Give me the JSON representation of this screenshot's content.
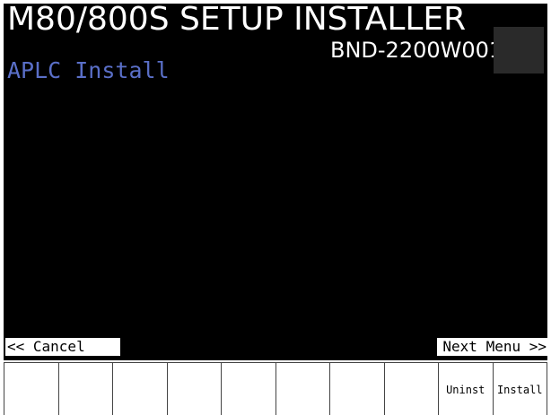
{
  "header": {
    "title": "M80/800S SETUP INSTALLER",
    "version": "BND-2200W001"
  },
  "screen": {
    "subtitle": "APLC Install"
  },
  "nav": {
    "cancel_label": "<< Cancel",
    "next_label": "Next Menu >>"
  },
  "softkeys": [
    "",
    "",
    "",
    "",
    "",
    "",
    "",
    "",
    "Uninst",
    "Install"
  ]
}
